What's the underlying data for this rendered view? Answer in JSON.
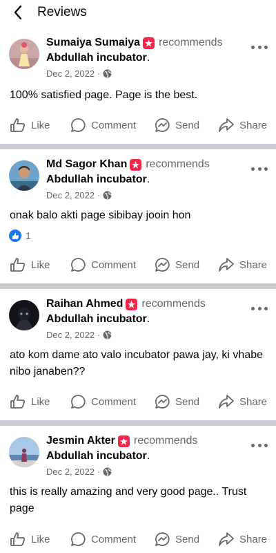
{
  "header": {
    "title": "Reviews"
  },
  "recommend_word": "recommends",
  "actions": {
    "like": "Like",
    "comment": "Comment",
    "send": "Send",
    "share": "Share"
  },
  "posts": [
    {
      "author": "Sumaiya Sumaiya",
      "page": "Abdullah incubator",
      "date": "Dec 2, 2022",
      "text": "100% satisfied page. Page is the best.",
      "reaction_count": ""
    },
    {
      "author": "Md Sagor Khan",
      "page": "Abdullah incubator",
      "date": "Dec 2, 2022",
      "text": "onak balo akti page sibibay jooin hon",
      "reaction_count": "1"
    },
    {
      "author": "Raihan Ahmed",
      "page": "Abdullah incubator",
      "date": "Dec 2, 2022",
      "text": "ato kom dame ato valo incubator pawa jay, ki vhabe nibo janaben??",
      "reaction_count": ""
    },
    {
      "author": "Jesmin Akter",
      "page": "Abdullah incubator",
      "date": "Dec 2, 2022",
      "text": "this is really amazing and very good page.. Trust page",
      "reaction_count": ""
    }
  ],
  "colors": {
    "secondary_text": "#65676b",
    "recommend_badge": "#f02849",
    "like_blue": "#1877f2",
    "separator": "#c9ccd1"
  },
  "icons": [
    "back-arrow-icon",
    "recommend-badge-icon",
    "globe-icon",
    "more-icon",
    "like-icon",
    "comment-icon",
    "send-icon",
    "share-icon",
    "like-reaction-icon"
  ]
}
